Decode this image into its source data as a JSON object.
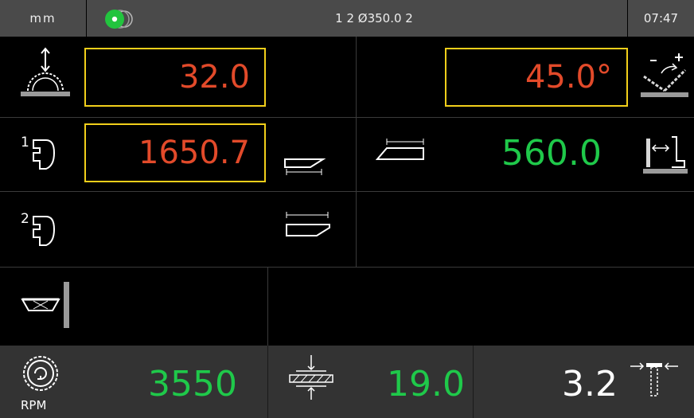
{
  "header": {
    "unit": "mm",
    "title": "1 2 Ø350.0 2",
    "time": "07:47",
    "status_icon": "saw-status-indicator-icon"
  },
  "fields": {
    "saw_height": "32.0",
    "bevel_angle": "45.0°",
    "fence1_position": "1650.7",
    "cut_width": "560.0"
  },
  "bottom": {
    "rpm_value": "3550",
    "rpm_label": "RPM",
    "scoring_value": "19.0",
    "right_value": "3.2"
  },
  "colors": {
    "highlight_border": "#f2cf1a",
    "set_value": "#e24a2a",
    "actual_value": "#1fc94a",
    "topbar": "#4a4a4a",
    "bottombar": "#333333"
  }
}
